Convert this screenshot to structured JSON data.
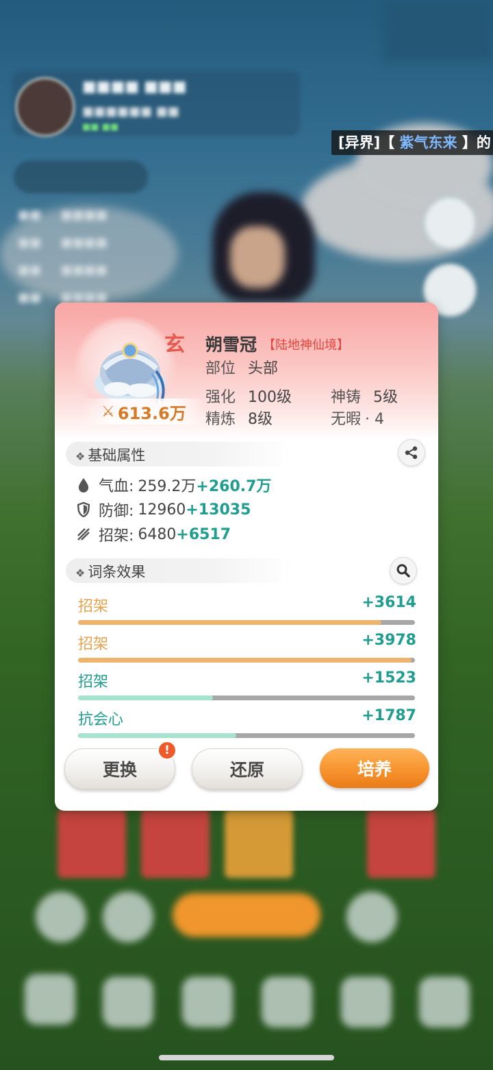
{
  "marquee": {
    "prefix": "[异界]【 ",
    "highlight": "紫气东来",
    "suffix": " 】的"
  },
  "item": {
    "name": "朔雪冠",
    "realm": "【陆地神仙境】",
    "tier_mark": "玄",
    "power_icon": "crossed-swords-icon",
    "power": "613.6万",
    "slot_label": "部位",
    "slot_value": "头部",
    "enhance_label": "强化",
    "enhance_value": "100级",
    "forge_label": "神铸",
    "forge_value": "5级",
    "refine_label": "精炼",
    "refine_value": "8级",
    "flawless_label": "无暇",
    "flawless_value": "· 4"
  },
  "base_section": {
    "title": "基础属性",
    "share_icon": "share-icon",
    "attrs": [
      {
        "icon": "drop-icon",
        "label": "气血:",
        "base": "259.2万",
        "bonus": "+260.7万"
      },
      {
        "icon": "shield-icon",
        "label": "防御:",
        "base": "12960",
        "bonus": "+13035"
      },
      {
        "icon": "parry-icon",
        "label": "招架:",
        "base": "6480",
        "bonus": "+6517"
      }
    ]
  },
  "affix_section": {
    "title": "词条效果",
    "search_icon": "search-icon",
    "affixes": [
      {
        "label": "招架",
        "value": "+3614",
        "fill": 0.9,
        "color": "#e8a24e",
        "bar": "#eeb36c"
      },
      {
        "label": "招架",
        "value": "+3978",
        "fill": 0.99,
        "color": "#e8a24e",
        "bar": "#eeb36c"
      },
      {
        "label": "招架",
        "value": "+1523",
        "fill": 0.4,
        "color": "#1f9d8e",
        "bar": "#a6e3cf"
      },
      {
        "label": "抗会心",
        "value": "+1787",
        "fill": 0.47,
        "color": "#1f9d8e",
        "bar": "#a6e3cf"
      }
    ]
  },
  "buttons": {
    "replace": "更换",
    "restore": "还原",
    "train": "培养",
    "alert": "!"
  },
  "colors": {
    "accent_teal": "#1f9d8e",
    "accent_orange": "#f7932d",
    "realm_red": "#e2463e"
  }
}
